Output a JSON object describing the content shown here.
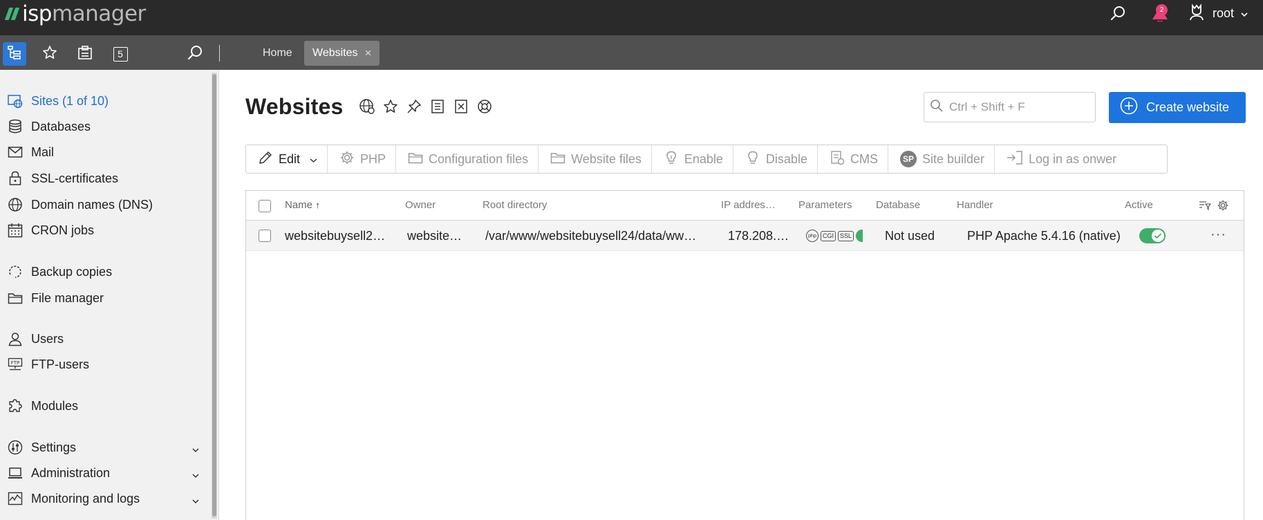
{
  "brand": {
    "name_bold": "isp",
    "name_light": "manager"
  },
  "topbar": {
    "notifications_count": "2",
    "user_name": "root"
  },
  "tabs": [
    {
      "label": "Home"
    },
    {
      "label": "Websites",
      "close": "×"
    }
  ],
  "toolbar_left": {
    "counter_label": "5"
  },
  "sidebar": {
    "items": [
      {
        "label": "Sites (1 of 10)"
      },
      {
        "label": "Databases"
      },
      {
        "label": "Mail"
      },
      {
        "label": "SSL-certificates"
      },
      {
        "label": "Domain names (DNS)"
      },
      {
        "label": "CRON jobs"
      },
      {
        "label": "Backup copies"
      },
      {
        "label": "File manager"
      },
      {
        "label": "Users"
      },
      {
        "label": "FTP-users"
      },
      {
        "label": "Modules"
      },
      {
        "label": "Settings"
      },
      {
        "label": "Administration"
      },
      {
        "label": "Monitoring and logs"
      }
    ]
  },
  "page": {
    "title": "Websites",
    "search_placeholder": "Ctrl + Shift + F",
    "create_label": "Create website"
  },
  "actions": [
    {
      "label": "Edit"
    },
    {
      "label": "PHP"
    },
    {
      "label": "Configuration files"
    },
    {
      "label": "Website files"
    },
    {
      "label": "Enable"
    },
    {
      "label": "Disable"
    },
    {
      "label": "CMS"
    },
    {
      "label": "Site builder",
      "badge": "SP"
    },
    {
      "label": "Log in as onwer"
    }
  ],
  "table": {
    "columns": {
      "name": "Name",
      "sort": "↑",
      "owner": "Owner",
      "root": "Root directory",
      "ip": "IP addres…",
      "params": "Parameters",
      "database": "Database",
      "handler": "Handler",
      "active": "Active"
    },
    "rows": [
      {
        "name": "websitebuysell2…",
        "owner": "website…",
        "root": "/var/www/websitebuysell24/data/ww…",
        "ip": "178.208.…",
        "params": [
          "php",
          "CGI",
          "SSL"
        ],
        "database": "Not used",
        "handler": "PHP Apache 5.4.16 (native)",
        "more": "···"
      }
    ]
  },
  "colors": {
    "accent": "#1e74de",
    "success": "#3fae6b",
    "badge": "#e8407a"
  }
}
